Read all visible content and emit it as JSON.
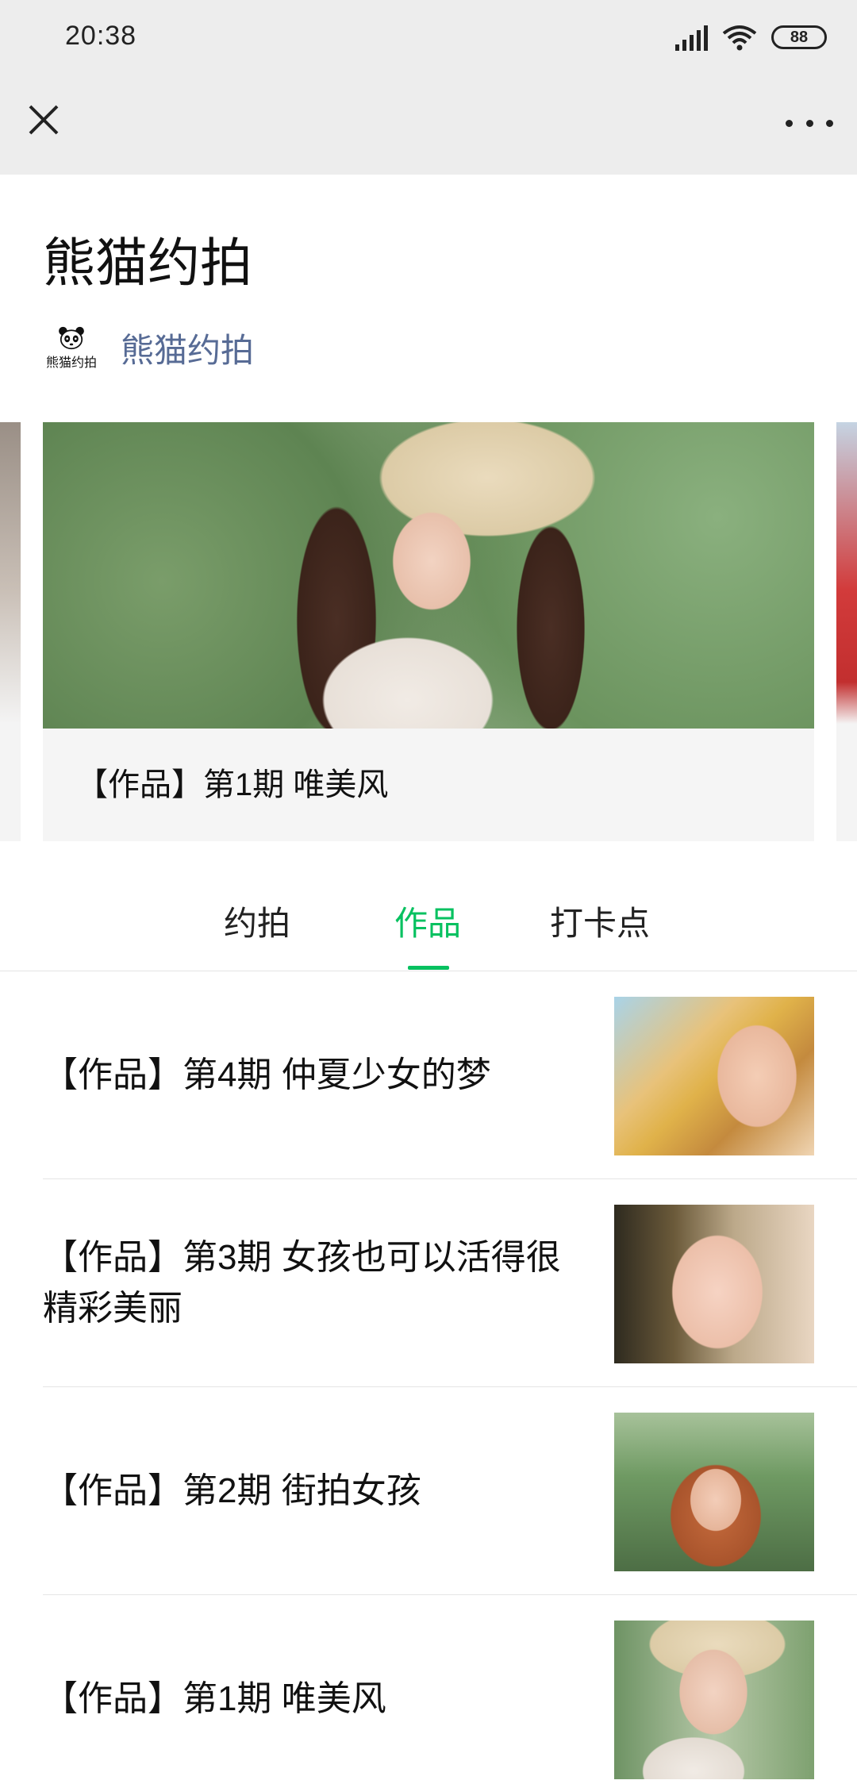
{
  "status_bar": {
    "time": "20:38",
    "battery": "88"
  },
  "nav": {
    "close_icon": "close-icon",
    "more_icon": "more-icon"
  },
  "header": {
    "title": "熊猫约拍",
    "account_name": "熊猫约拍",
    "logo_text": "熊猫约拍"
  },
  "carousel": {
    "caption": "【作品】第1期 唯美风"
  },
  "tabs": [
    {
      "label": "约拍"
    },
    {
      "label": "作品"
    },
    {
      "label": "打卡点"
    }
  ],
  "active_tab": "作品",
  "accent_color": "#07c160",
  "link_color": "#576b95",
  "list": [
    {
      "title": "【作品】第4期 仲夏少女的梦"
    },
    {
      "title": "【作品】第3期 女孩也可以活得很精彩美丽"
    },
    {
      "title": "【作品】第2期 街拍女孩"
    },
    {
      "title": "【作品】第1期 唯美风"
    }
  ]
}
